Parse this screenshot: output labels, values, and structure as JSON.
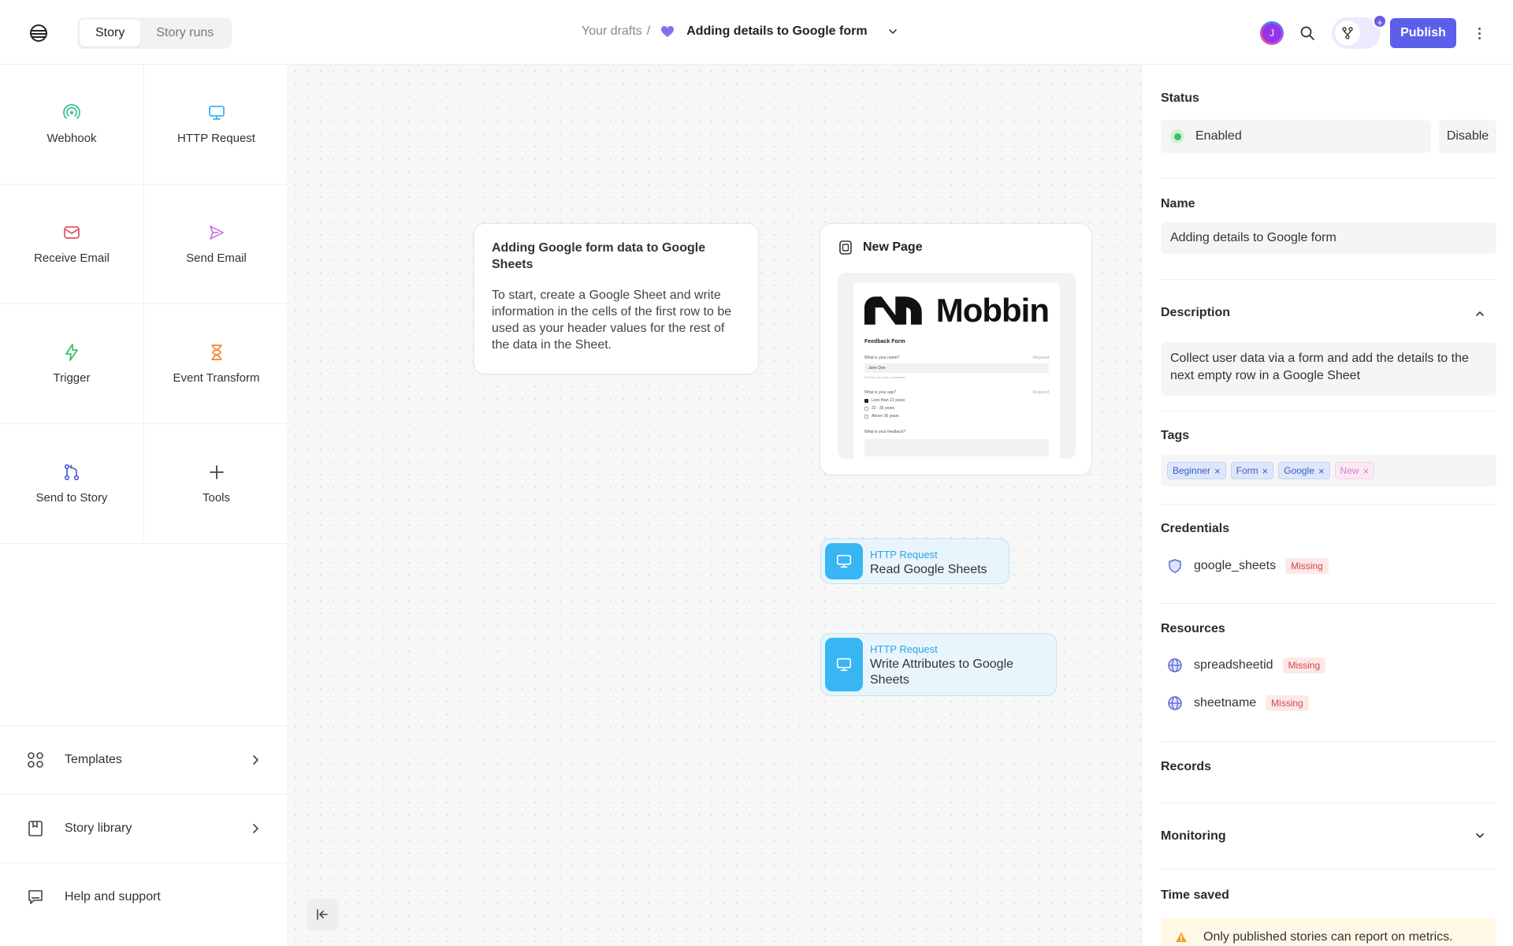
{
  "header": {
    "tabs": [
      {
        "label": "Story",
        "active": true
      },
      {
        "label": "Story runs",
        "active": false
      }
    ],
    "breadcrumb_parent": "Your drafts",
    "breadcrumb_sep": "/",
    "story_title": "Adding details to Google form",
    "avatar_initial": "J",
    "publish_label": "Publish"
  },
  "sidebar": {
    "tools": [
      {
        "label": "Webhook",
        "icon": "webhook-icon",
        "color": "#3fbf9a"
      },
      {
        "label": "HTTP Request",
        "icon": "monitor-icon",
        "color": "#38b6f4"
      },
      {
        "label": "Receive Email",
        "icon": "mail-icon",
        "color": "#e05a6a"
      },
      {
        "label": "Send Email",
        "icon": "send-icon",
        "color": "#c67de0"
      },
      {
        "label": "Trigger",
        "icon": "bolt-icon",
        "color": "#3fbf6a"
      },
      {
        "label": "Event Transform",
        "icon": "hourglass-icon",
        "color": "#f08a3a"
      },
      {
        "label": "Send to Story",
        "icon": "git-branch-icon",
        "color": "#4a5fd6"
      },
      {
        "label": "Tools",
        "icon": "plus-icon",
        "color": "#444444"
      }
    ],
    "links": [
      {
        "label": "Templates",
        "icon": "grid-icon"
      },
      {
        "label": "Story library",
        "icon": "bookmark-icon"
      },
      {
        "label": "Help and support",
        "icon": "chat-icon"
      }
    ]
  },
  "canvas": {
    "note": {
      "title": "Adding Google form data to Google Sheets",
      "body": "To start, create a Google Sheet and write information in the cells of the first row to be used as your header values for the rest of the data in the Sheet."
    },
    "page_card": {
      "title": "New Page",
      "preview": {
        "brand": "Mobbin",
        "form_title": "Feedback Form",
        "q1": "What is your name?",
        "q1_required": "Required",
        "q1_value": "Jane Doe",
        "q1_hint": "Feel free to leave a nickname",
        "q2": "What is your age?",
        "q2_required": "Required",
        "q2_options": [
          "Less than 21 years",
          "22 - 35 years",
          "Above 36 years"
        ],
        "q3": "What is your feedback?"
      }
    },
    "actions": [
      {
        "type": "HTTP Request",
        "name": "Read Google Sheets"
      },
      {
        "type": "HTTP Request",
        "name": "Write Attributes to Google Sheets"
      }
    ]
  },
  "panel": {
    "status_title": "Status",
    "status_value": "Enabled",
    "disable_label": "Disable",
    "name_title": "Name",
    "name_value": "Adding details to Google form",
    "description_title": "Description",
    "description_value": "Collect user data via a form and add the details to the next empty row in a Google Sheet",
    "tags_title": "Tags",
    "tags": [
      {
        "label": "Beginner",
        "style": "blue"
      },
      {
        "label": "Form",
        "style": "blue"
      },
      {
        "label": "Google",
        "style": "blue"
      },
      {
        "label": "New",
        "style": "pink"
      }
    ],
    "credentials_title": "Credentials",
    "credentials": [
      {
        "label": "google_sheets",
        "badge": "Missing"
      }
    ],
    "resources_title": "Resources",
    "resources": [
      {
        "label": "spreadsheetid",
        "badge": "Missing"
      },
      {
        "label": "sheetname",
        "badge": "Missing"
      }
    ],
    "records_title": "Records",
    "monitoring_title": "Monitoring",
    "time_saved_title": "Time saved",
    "alert_text": "Only published stories can report on metrics."
  },
  "colors": {
    "accent": "#5b5fe9",
    "action_blue": "#38b6f4",
    "enabled_green": "#3fbf5b",
    "missing_red": "#d04848"
  }
}
